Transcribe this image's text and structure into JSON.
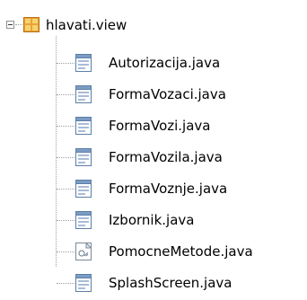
{
  "tree": {
    "root": {
      "label": "hlavati.view",
      "icon": "package-icon",
      "expanded": true
    },
    "files": [
      {
        "label": "Autorizacija.java",
        "icon": "java-form-icon"
      },
      {
        "label": "FormaVozaci.java",
        "icon": "java-form-icon"
      },
      {
        "label": "FormaVozi.java",
        "icon": "java-form-icon"
      },
      {
        "label": "FormaVozila.java",
        "icon": "java-form-icon"
      },
      {
        "label": "FormaVoznje.java",
        "icon": "java-form-icon"
      },
      {
        "label": "Izbornik.java",
        "icon": "java-form-icon"
      },
      {
        "label": "PomocneMetode.java",
        "icon": "java-class-icon"
      },
      {
        "label": "SplashScreen.java",
        "icon": "java-form-icon"
      }
    ],
    "colors": {
      "package_orange": "#e8a33d",
      "package_yellow": "#f6d36b",
      "file_blue": "#5b7fa8",
      "connector": "#a0a0a0"
    }
  }
}
